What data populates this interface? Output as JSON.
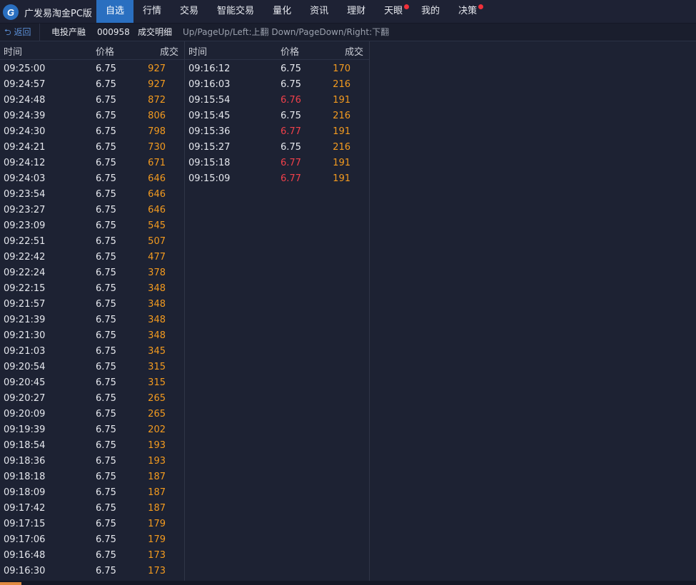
{
  "app": {
    "title": "广发易淘金PC版",
    "logo_glyph": "G"
  },
  "nav": [
    {
      "label": "自选",
      "active": true,
      "badge": false
    },
    {
      "label": "行情",
      "active": false,
      "badge": false
    },
    {
      "label": "交易",
      "active": false,
      "badge": false
    },
    {
      "label": "智能交易",
      "active": false,
      "badge": false
    },
    {
      "label": "量化",
      "active": false,
      "badge": false
    },
    {
      "label": "资讯",
      "active": false,
      "badge": false
    },
    {
      "label": "理财",
      "active": false,
      "badge": false
    },
    {
      "label": "天眼",
      "active": false,
      "badge": true
    },
    {
      "label": "我的",
      "active": false,
      "badge": false
    },
    {
      "label": "决策",
      "active": false,
      "badge": true
    }
  ],
  "subbar": {
    "back_label": "返回",
    "stock_name": "电投产融",
    "stock_code": "000958",
    "title": "成交明细",
    "hint": "Up/PageUp/Left:上翻 Down/PageDown/Right:下翻"
  },
  "columns": {
    "time": "时间",
    "price": "价格",
    "volume": "成交"
  },
  "colors": {
    "up": "#f0404a",
    "volume": "#f49b1f",
    "active_tab": "#2a6fc0"
  },
  "trades": [
    [
      {
        "time": "09:25:00",
        "price": "6.75",
        "volume": "927",
        "up": false
      },
      {
        "time": "09:24:57",
        "price": "6.75",
        "volume": "927",
        "up": false
      },
      {
        "time": "09:24:48",
        "price": "6.75",
        "volume": "872",
        "up": false
      },
      {
        "time": "09:24:39",
        "price": "6.75",
        "volume": "806",
        "up": false
      },
      {
        "time": "09:24:30",
        "price": "6.75",
        "volume": "798",
        "up": false
      },
      {
        "time": "09:24:21",
        "price": "6.75",
        "volume": "730",
        "up": false
      },
      {
        "time": "09:24:12",
        "price": "6.75",
        "volume": "671",
        "up": false
      },
      {
        "time": "09:24:03",
        "price": "6.75",
        "volume": "646",
        "up": false
      },
      {
        "time": "09:23:54",
        "price": "6.75",
        "volume": "646",
        "up": false
      },
      {
        "time": "09:23:27",
        "price": "6.75",
        "volume": "646",
        "up": false
      },
      {
        "time": "09:23:09",
        "price": "6.75",
        "volume": "545",
        "up": false
      },
      {
        "time": "09:22:51",
        "price": "6.75",
        "volume": "507",
        "up": false
      },
      {
        "time": "09:22:42",
        "price": "6.75",
        "volume": "477",
        "up": false
      },
      {
        "time": "09:22:24",
        "price": "6.75",
        "volume": "378",
        "up": false
      },
      {
        "time": "09:22:15",
        "price": "6.75",
        "volume": "348",
        "up": false
      },
      {
        "time": "09:21:57",
        "price": "6.75",
        "volume": "348",
        "up": false
      },
      {
        "time": "09:21:39",
        "price": "6.75",
        "volume": "348",
        "up": false
      },
      {
        "time": "09:21:30",
        "price": "6.75",
        "volume": "348",
        "up": false
      },
      {
        "time": "09:21:03",
        "price": "6.75",
        "volume": "345",
        "up": false
      },
      {
        "time": "09:20:54",
        "price": "6.75",
        "volume": "315",
        "up": false
      },
      {
        "time": "09:20:45",
        "price": "6.75",
        "volume": "315",
        "up": false
      },
      {
        "time": "09:20:27",
        "price": "6.75",
        "volume": "265",
        "up": false
      },
      {
        "time": "09:20:09",
        "price": "6.75",
        "volume": "265",
        "up": false
      },
      {
        "time": "09:19:39",
        "price": "6.75",
        "volume": "202",
        "up": false
      },
      {
        "time": "09:18:54",
        "price": "6.75",
        "volume": "193",
        "up": false
      },
      {
        "time": "09:18:36",
        "price": "6.75",
        "volume": "193",
        "up": false
      },
      {
        "time": "09:18:18",
        "price": "6.75",
        "volume": "187",
        "up": false
      },
      {
        "time": "09:18:09",
        "price": "6.75",
        "volume": "187",
        "up": false
      },
      {
        "time": "09:17:42",
        "price": "6.75",
        "volume": "187",
        "up": false
      },
      {
        "time": "09:17:15",
        "price": "6.75",
        "volume": "179",
        "up": false
      },
      {
        "time": "09:17:06",
        "price": "6.75",
        "volume": "179",
        "up": false
      },
      {
        "time": "09:16:48",
        "price": "6.75",
        "volume": "173",
        "up": false
      },
      {
        "time": "09:16:30",
        "price": "6.75",
        "volume": "173",
        "up": false
      }
    ],
    [
      {
        "time": "09:16:12",
        "price": "6.75",
        "volume": "170",
        "up": false
      },
      {
        "time": "09:16:03",
        "price": "6.75",
        "volume": "216",
        "up": false
      },
      {
        "time": "09:15:54",
        "price": "6.76",
        "volume": "191",
        "up": true
      },
      {
        "time": "09:15:45",
        "price": "6.75",
        "volume": "216",
        "up": false
      },
      {
        "time": "09:15:36",
        "price": "6.77",
        "volume": "191",
        "up": true
      },
      {
        "time": "09:15:27",
        "price": "6.75",
        "volume": "216",
        "up": false
      },
      {
        "time": "09:15:18",
        "price": "6.77",
        "volume": "191",
        "up": true
      },
      {
        "time": "09:15:09",
        "price": "6.77",
        "volume": "191",
        "up": true
      }
    ]
  ]
}
